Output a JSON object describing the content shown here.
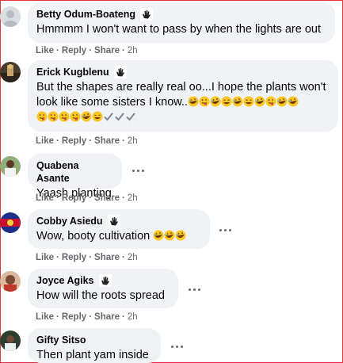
{
  "comments": [
    {
      "name": "Betty Odum-Boateng",
      "text": "Hmmmm I won't want to pass by when the lights are out",
      "actions": {
        "like": "Like",
        "reply": "Reply",
        "share": "Share",
        "time": "2h"
      }
    },
    {
      "name": "Erick Kugblenu",
      "text_line1": "But the shapes are really real oo...I hope the plants won't",
      "text_line2": "look like some sisters I know..",
      "actions": {
        "like": "Like",
        "reply": "Reply",
        "share": "Share",
        "time": "2h"
      }
    },
    {
      "name": "Quabena Asante",
      "text": "Yaash planting",
      "actions": {
        "like": "Like",
        "reply": "Reply",
        "share": "Share",
        "time": "2h"
      }
    },
    {
      "name": "Cobby Asiedu",
      "text": "Wow, booty cultivation",
      "actions": {
        "like": "Like",
        "reply": "Reply",
        "share": "Share",
        "time": "2h"
      }
    },
    {
      "name": "Joyce Agiks",
      "text": "How will the roots spread",
      "actions": {
        "like": "Like",
        "reply": "Reply",
        "share": "Share",
        "time": "2h"
      }
    },
    {
      "name": "Gifty Sitso",
      "text": "Then plant yam inside"
    }
  ],
  "icons": {
    "wave": "waving-hand-icon",
    "more": "more-options-icon",
    "emoji_laugh": "rolling-laughing-emoji",
    "emoji_grin": "grinning-squint-emoji",
    "emoji_tongue": "winking-tongue-emoji",
    "emoji_check": "check-mark-emoji"
  },
  "colors": {
    "bubble": "#f0f2f5",
    "meta": "#65676b",
    "frame": "#e03a3a"
  }
}
